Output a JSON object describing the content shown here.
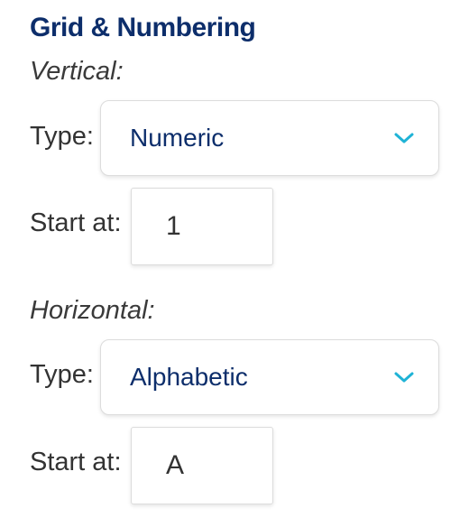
{
  "panel": {
    "title": "Grid & Numbering",
    "vertical": {
      "section_label": "Vertical:",
      "type_label": "Type:",
      "type_value": "Numeric",
      "start_label": "Start at:",
      "start_value": "1"
    },
    "horizontal": {
      "section_label": "Horizontal:",
      "type_label": "Type:",
      "type_value": "Alphabetic",
      "start_label": "Start at:",
      "start_value": "A"
    }
  },
  "icons": {
    "dropdown": "chevron-down-icon"
  },
  "colors": {
    "title": "#0d2e6b",
    "select_value": "#0d2e6b",
    "chevron": "#1fb3d6",
    "label": "#333333"
  }
}
